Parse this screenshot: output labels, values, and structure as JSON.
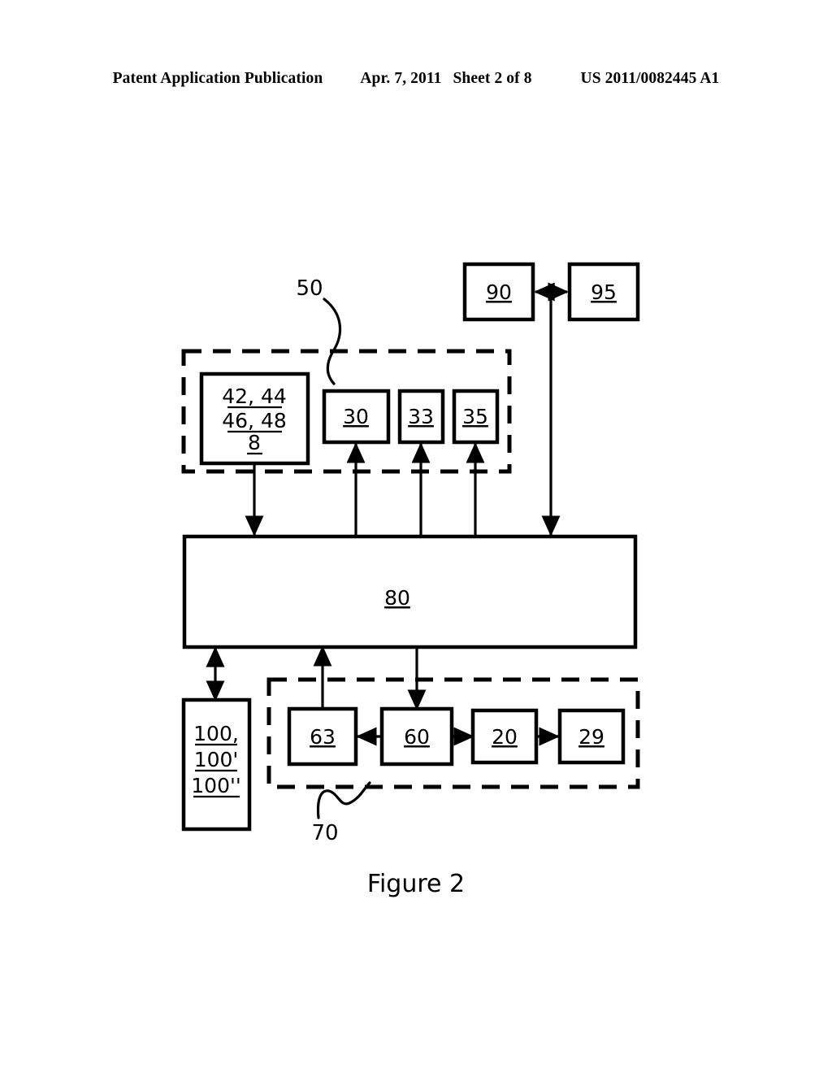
{
  "header": {
    "publication": "Patent Application Publication",
    "date": "Apr. 7, 2011",
    "sheet": "Sheet 2 of 8",
    "docnumber": "US 2011/0082445 A1"
  },
  "figure": {
    "caption": "Figure 2"
  },
  "diagram": {
    "type": "block-diagram",
    "boxes": {
      "b90": {
        "label": "90"
      },
      "b95": {
        "label": "95"
      },
      "b_multi_top": {
        "line1": "42, 44",
        "line2": "46, 48",
        "line3": "8"
      },
      "b30": {
        "label": "30"
      },
      "b33": {
        "label": "33"
      },
      "b35": {
        "label": "35"
      },
      "b80": {
        "label": "80"
      },
      "b100": {
        "line1": "100,",
        "line2": "100'",
        "line3": "100''"
      },
      "b63": {
        "label": "63"
      },
      "b60": {
        "label": "60"
      },
      "b20": {
        "label": "20"
      },
      "b29": {
        "label": "29"
      }
    },
    "group_labels": {
      "g50": "50",
      "g70": "70"
    },
    "colors": {
      "stroke": "#000000",
      "fill": "#ffffff"
    }
  }
}
